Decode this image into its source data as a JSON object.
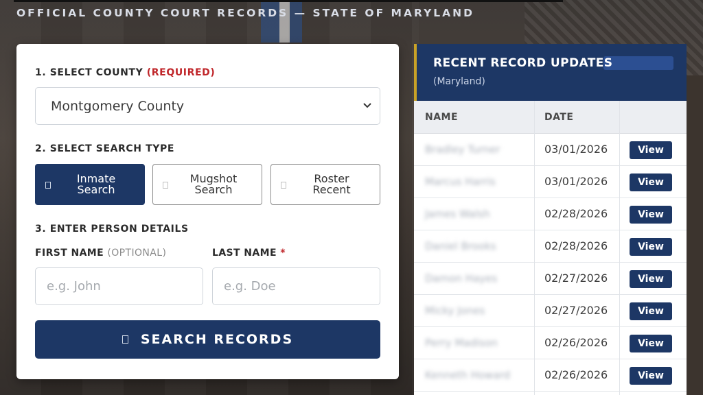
{
  "header": {
    "title": "OFFICIAL COUNTY COURT RECORDS — STATE OF MARYLAND"
  },
  "search_form": {
    "county_label": "1. SELECT COUNTY",
    "county_required": "(REQUIRED)",
    "county_value": "Montgomery County",
    "type_label": "2. SELECT SEARCH TYPE",
    "types": [
      {
        "line1": "Inmate",
        "line2": "Search",
        "active": true
      },
      {
        "line1": "Mugshot",
        "line2": "Search",
        "active": false
      },
      {
        "line1": "Roster",
        "line2": "Recent",
        "active": false
      }
    ],
    "person_label": "3. ENTER PERSON DETAILS",
    "first_name_label": "FIRST NAME",
    "first_name_optional": "(OPTIONAL)",
    "first_name_placeholder": "e.g. John",
    "last_name_label": "LAST NAME",
    "last_name_star": "*",
    "last_name_placeholder": "e.g. Doe",
    "search_button": "SEARCH RECORDS"
  },
  "recent": {
    "title": "RECENT RECORD UPDATES",
    "subtitle": "(Maryland)",
    "columns": {
      "name": "NAME",
      "date": "DATE"
    },
    "rows": [
      {
        "name": "Bradley Turner",
        "date": "03/01/2026",
        "action": "View"
      },
      {
        "name": "Marcus Harris",
        "date": "03/01/2026",
        "action": "View"
      },
      {
        "name": "James Walsh",
        "date": "02/28/2026",
        "action": "View"
      },
      {
        "name": "Daniel Brooks",
        "date": "02/28/2026",
        "action": "View"
      },
      {
        "name": "Damon Hayes",
        "date": "02/27/2026",
        "action": "View"
      },
      {
        "name": "Micky Jones",
        "date": "02/27/2026",
        "action": "View"
      },
      {
        "name": "Perry Madison",
        "date": "02/26/2026",
        "action": "View"
      },
      {
        "name": "Kenneth Howard",
        "date": "02/26/2026",
        "action": "View"
      }
    ]
  },
  "colors": {
    "navy": "#1d3765",
    "accent_gold": "#c9a227",
    "required_red": "#c0262a"
  }
}
